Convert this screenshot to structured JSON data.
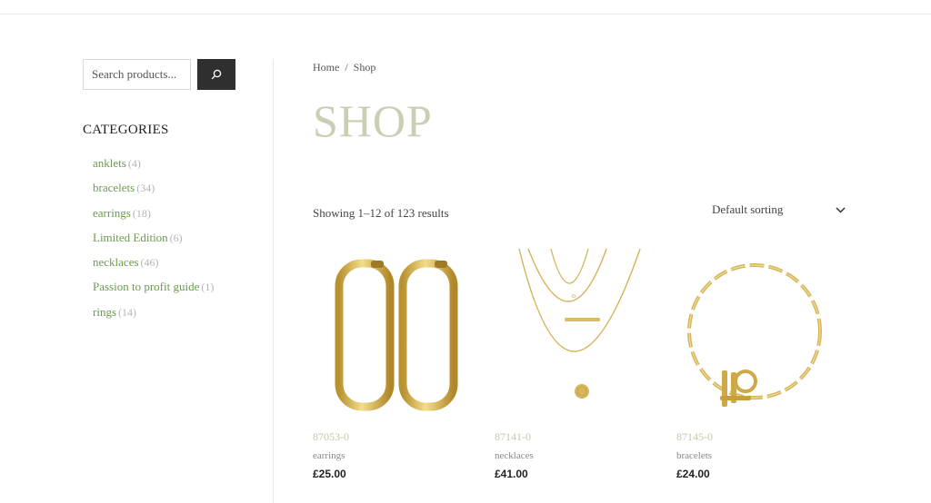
{
  "search": {
    "placeholder": "Search products..."
  },
  "categories": {
    "title": "CATEGORIES",
    "items": [
      {
        "label": "anklets",
        "count": "(4)"
      },
      {
        "label": "bracelets",
        "count": "(34)"
      },
      {
        "label": "earrings",
        "count": "(18)"
      },
      {
        "label": "Limited Edition",
        "count": "(6)"
      },
      {
        "label": "necklaces",
        "count": "(46)"
      },
      {
        "label": "Passion to profit guide",
        "count": "(1)"
      },
      {
        "label": "rings",
        "count": "(14)"
      }
    ]
  },
  "breadcrumb": {
    "home": "Home",
    "separator": "/",
    "current": "Shop"
  },
  "page_title": "SHOP",
  "results_text": "Showing 1–12 of 123 results",
  "sorting": {
    "selected": "Default sorting"
  },
  "products": [
    {
      "sku": "87053-0",
      "category": "earrings",
      "price": "£25.00",
      "image_icon": "gold-hoop-earrings"
    },
    {
      "sku": "87141-0",
      "category": "necklaces",
      "price": "£41.00",
      "image_icon": "layered-gold-necklace"
    },
    {
      "sku": "87145-0",
      "category": "bracelets",
      "price": "£24.00",
      "image_icon": "gold-chain-bracelet"
    }
  ],
  "colors": {
    "accent_green": "#6d9a4f",
    "title": "#c9cfb5",
    "button_dark": "#2f2f2f",
    "gold": "#d4b35a"
  }
}
